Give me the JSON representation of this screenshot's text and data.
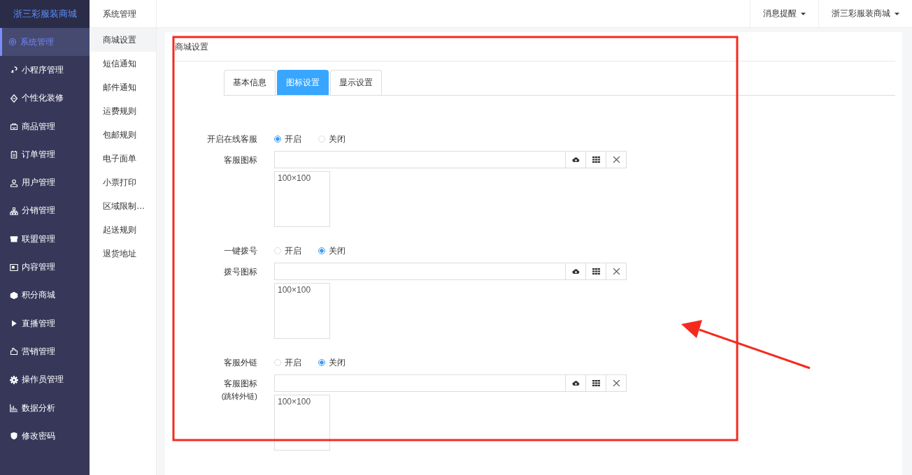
{
  "sidebar": {
    "logo": "浙三彩服装商城",
    "items": [
      {
        "label": "系统管理",
        "selected": true
      },
      {
        "label": "小程序管理",
        "selected": false
      },
      {
        "label": "个性化装修",
        "selected": false
      },
      {
        "label": "商品管理",
        "selected": false
      },
      {
        "label": "订单管理",
        "selected": false
      },
      {
        "label": "用户管理",
        "selected": false
      },
      {
        "label": "分销管理",
        "selected": false
      },
      {
        "label": "联盟管理",
        "selected": false
      },
      {
        "label": "内容管理",
        "selected": false
      },
      {
        "label": "积分商城",
        "selected": false
      },
      {
        "label": "直播管理",
        "selected": false
      },
      {
        "label": "营销管理",
        "selected": false
      },
      {
        "label": "操作员管理",
        "selected": false
      },
      {
        "label": "数据分析",
        "selected": false
      },
      {
        "label": "修改密码",
        "selected": false
      }
    ]
  },
  "submenu": {
    "title": "系统管理",
    "items": [
      {
        "label": "商城设置",
        "selected": true
      },
      {
        "label": "短信通知",
        "selected": false
      },
      {
        "label": "邮件通知",
        "selected": false
      },
      {
        "label": "运费规则",
        "selected": false
      },
      {
        "label": "包邮规则",
        "selected": false
      },
      {
        "label": "电子面单",
        "selected": false
      },
      {
        "label": "小票打印",
        "selected": false
      },
      {
        "label": "区域限制…",
        "selected": false
      },
      {
        "label": "起送规则",
        "selected": false
      },
      {
        "label": "退货地址",
        "selected": false
      }
    ]
  },
  "topbar": {
    "menus": [
      "消息提醒",
      "浙三彩服装商城"
    ]
  },
  "panel": {
    "title": "商城设置",
    "tabs": [
      {
        "label": "基本信息",
        "selected": false
      },
      {
        "label": "图标设置",
        "selected": true
      },
      {
        "label": "显示设置",
        "selected": false
      }
    ],
    "fields": [
      {
        "kind": "radio",
        "label": "开启在线客服",
        "options": [
          {
            "label": "开启",
            "selected": true
          },
          {
            "label": "关闭",
            "selected": false
          }
        ]
      },
      {
        "kind": "image",
        "label": "客服图标",
        "preview_text": "100×100"
      },
      {
        "kind": "radio",
        "label": "一键拨号",
        "options": [
          {
            "label": "开启",
            "selected": false
          },
          {
            "label": "关闭",
            "selected": true
          }
        ]
      },
      {
        "kind": "image",
        "label": "拨号图标",
        "preview_text": "100×100"
      },
      {
        "kind": "radio",
        "label": "客服外链",
        "options": [
          {
            "label": "开启",
            "selected": false
          },
          {
            "label": "关闭",
            "selected": true
          }
        ]
      },
      {
        "kind": "image",
        "label": "客服图标",
        "sublabel": "(跳转外链)",
        "preview_text": "100×100"
      }
    ]
  }
}
